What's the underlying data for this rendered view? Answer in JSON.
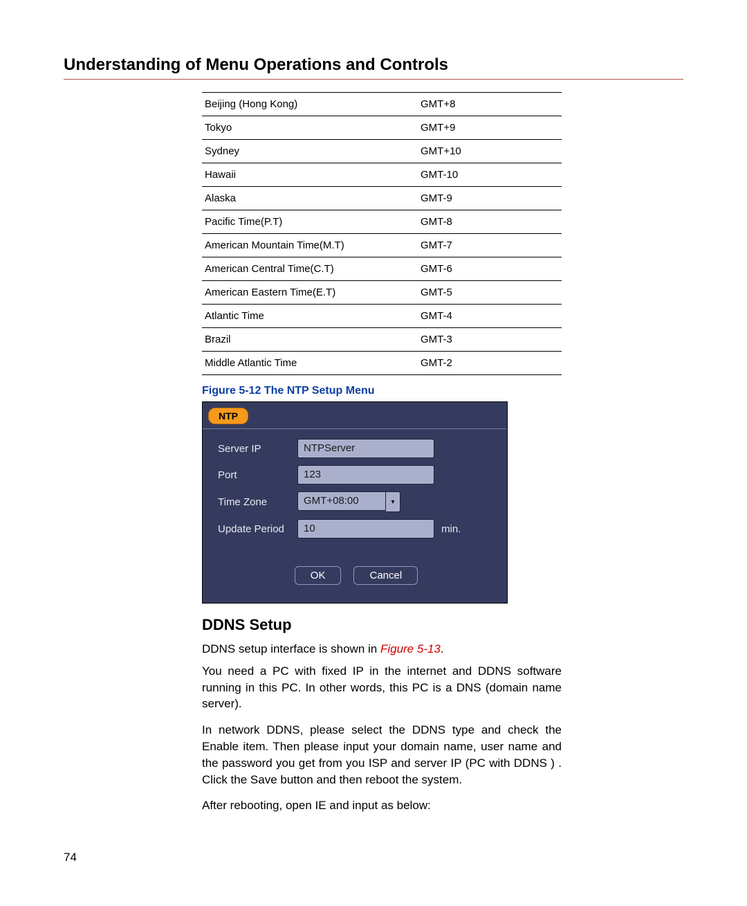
{
  "heading": "Understanding of Menu Operations and Controls",
  "tz_table": [
    {
      "name": "Beijing (Hong Kong)",
      "offset": "GMT+8"
    },
    {
      "name": "Tokyo",
      "offset": "GMT+9"
    },
    {
      "name": "Sydney",
      "offset": "GMT+10"
    },
    {
      "name": "Hawaii",
      "offset": "GMT-10"
    },
    {
      "name": "Alaska",
      "offset": "GMT-9"
    },
    {
      "name": "Pacific Time(P.T)",
      "offset": "GMT-8"
    },
    {
      "name": "American  Mountain Time(M.T)",
      "offset": "GMT-7"
    },
    {
      "name": "American Central Time(C.T)",
      "offset": "GMT-6"
    },
    {
      "name": "American Eastern Time(E.T)",
      "offset": "GMT-5"
    },
    {
      "name": "Atlantic Time",
      "offset": "GMT-4"
    },
    {
      "name": "Brazil",
      "offset": "GMT-3"
    },
    {
      "name": "Middle Atlantic Time",
      "offset": "GMT-2"
    }
  ],
  "fig_caption": "Figure 5-12 The NTP Setup Menu",
  "ntp": {
    "tab": "NTP",
    "labels": {
      "server_ip": "Server IP",
      "port": "Port",
      "time_zone": "Time Zone",
      "update_period": "Update Period"
    },
    "values": {
      "server_ip": "NTPServer",
      "port": "123",
      "time_zone": "GMT+08:00",
      "update_period": "10"
    },
    "suffix_min": "min.",
    "buttons": {
      "ok": "OK",
      "cancel": "Cancel"
    }
  },
  "ddns": {
    "title": "DDNS Setup",
    "line1_pre": "DDNS setup interface is shown in ",
    "line1_ref": "Figure 5-13",
    "line1_post": ".",
    "para2": "You need a PC with fixed IP in the internet and DDNS software running in this PC. In other words, this PC is a DNS (domain name server).",
    "para3": "In network DDNS, please select the DDNS type and check the Enable item. Then please input your domain name, user name and the password you get from you ISP and server IP (PC with DDNS ) . Click the Save button and then reboot the system.",
    "para4": "After rebooting, open IE and input as below:"
  },
  "page_number": "74"
}
